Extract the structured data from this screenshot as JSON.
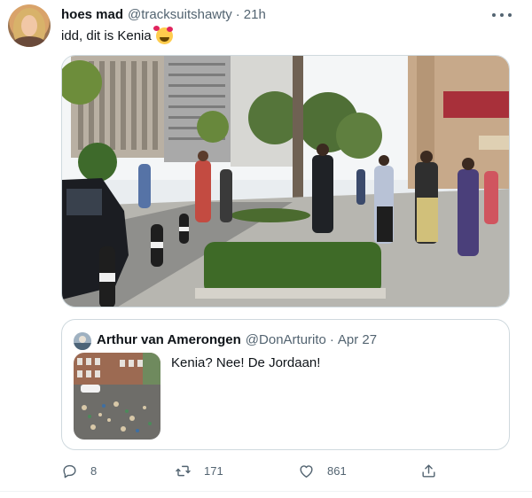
{
  "tweet": {
    "author_name": "hoes mad",
    "author_handle": "@tracksuitshawty",
    "separator": "·",
    "time": "21h",
    "text": "idd, dit is Kenia",
    "emoji_icon": "smiling-face-with-hearts-icon",
    "media_icon": "street-photo"
  },
  "quote": {
    "author_name": "Arthur van Amerongen",
    "author_handle": "@DonArturito",
    "separator": "·",
    "date": "Apr 27",
    "text": "Kenia? Nee! De Jordaan!",
    "thumbnail_icon": "littered-street-photo"
  },
  "actions": {
    "reply_count": "8",
    "retweet_count": "171",
    "like_count": "861",
    "reply_icon": "reply-icon",
    "retweet_icon": "retweet-icon",
    "like_icon": "heart-icon",
    "share_icon": "share-icon",
    "more_icon": "more-icon"
  },
  "colors": {
    "text_primary": "#0f1419",
    "text_secondary": "#536471",
    "border": "#cfd9de"
  }
}
